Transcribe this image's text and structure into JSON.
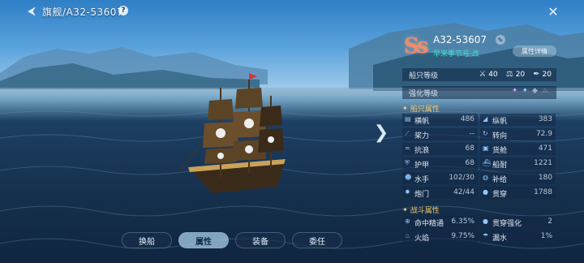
{
  "header": {
    "title": "旗舰/A32-53607",
    "help_label": "?"
  },
  "ship": {
    "grade": "Ss",
    "id": "A32-53607",
    "subtitle": "早来季节号·改",
    "detail_button": "属性详情"
  },
  "levels": {
    "label": "船只等级",
    "items": [
      {
        "icon": "crossed-swords-icon",
        "value": "40"
      },
      {
        "icon": "scales-icon",
        "value": "20"
      },
      {
        "icon": "quill-icon",
        "value": "20"
      }
    ]
  },
  "enhance": {
    "label": "强化等级"
  },
  "ship_attrs": {
    "heading": "船只属性",
    "rows": [
      {
        "l": {
          "name": "横帆",
          "value": "486"
        },
        "r": {
          "name": "纵帆",
          "value": "383"
        }
      },
      {
        "l": {
          "name": "桨力",
          "value": "--"
        },
        "r": {
          "name": "转向",
          "value": "72.9"
        }
      },
      {
        "l": {
          "name": "抗浪",
          "value": "68"
        },
        "r": {
          "name": "货舱",
          "value": "471"
        }
      },
      {
        "l": {
          "name": "护甲",
          "value": "68"
        },
        "r": {
          "name": "船耐",
          "value": "1221"
        }
      },
      {
        "l": {
          "name": "水手",
          "value": "102/30"
        },
        "r": {
          "name": "补给",
          "value": "180"
        }
      },
      {
        "l": {
          "name": "炮门",
          "value": "42/44"
        },
        "r": {
          "name": "贯穿",
          "value": "1788"
        }
      }
    ]
  },
  "combat_attrs": {
    "heading": "战斗属性",
    "rows": [
      {
        "l": {
          "name": "命中精通",
          "value": "6.35%"
        },
        "r": {
          "name": "贯穿强化",
          "value": "2"
        }
      },
      {
        "l": {
          "name": "火焰",
          "value": "9.75%"
        },
        "r": {
          "name": "漏水",
          "value": "1%"
        }
      }
    ]
  },
  "tabs": [
    "换船",
    "属性",
    "装备",
    "委任"
  ],
  "active_tab": "属性",
  "colors": {
    "accent": "#f1c66b",
    "grade": "#f08c6a",
    "subtitle": "#3ee0c8"
  }
}
